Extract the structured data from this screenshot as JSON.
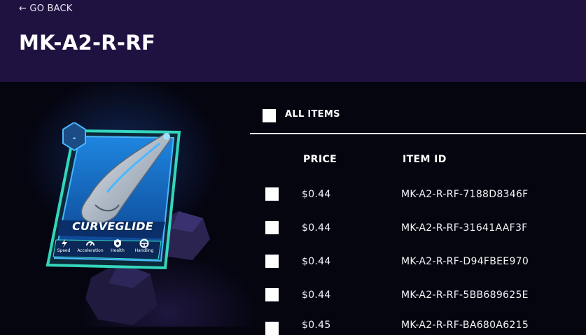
{
  "nav": {
    "go_back_label": "← GO BACK"
  },
  "page": {
    "title": "MK-A2-R-RF"
  },
  "card": {
    "name": "CURVEGLIDE",
    "rarity_badge": "-",
    "stats": [
      "Speed",
      "Acceleration",
      "Health",
      "Handling"
    ],
    "colors": {
      "frame": "#37e2c6",
      "panel": "#1a6fc8",
      "glow": "#49b8ff"
    }
  },
  "table": {
    "select_all_label": "ALL ITEMS",
    "columns": {
      "price": "PRICE",
      "item_id": "ITEM ID"
    },
    "rows": [
      {
        "price": "$0.44",
        "item_id": "MK-A2-R-RF-7188D8346F"
      },
      {
        "price": "$0.44",
        "item_id": "MK-A2-R-RF-31641AAF3F"
      },
      {
        "price": "$0.44",
        "item_id": "MK-A2-R-RF-D94FBEE970"
      },
      {
        "price": "$0.44",
        "item_id": "MK-A2-R-RF-5BB689625E"
      },
      {
        "price": "$0.45",
        "item_id": "MK-A2-R-RF-BA680A6215"
      }
    ]
  },
  "theme": {
    "header_bg": "#1f1240",
    "page_bg": "#050510",
    "text": "#ffffff"
  }
}
